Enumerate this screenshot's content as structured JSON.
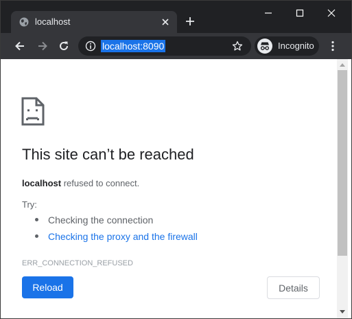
{
  "tab": {
    "title": "localhost",
    "icon": "globe-icon"
  },
  "toolbar": {
    "url": "localhost:8090",
    "incognito_label": "Incognito"
  },
  "error": {
    "title": "This site can’t be reached",
    "host": "localhost",
    "message": " refused to connect.",
    "try_label": "Try:",
    "suggestions": [
      "Checking the connection",
      "Checking the proxy and the firewall"
    ],
    "code": "ERR_CONNECTION_REFUSED"
  },
  "buttons": {
    "reload": "Reload",
    "details": "Details"
  },
  "colors": {
    "frame": "#202124",
    "toolbar": "#35363a",
    "accent": "#1a73e8",
    "text": "#202124",
    "muted": "#5f6368"
  }
}
